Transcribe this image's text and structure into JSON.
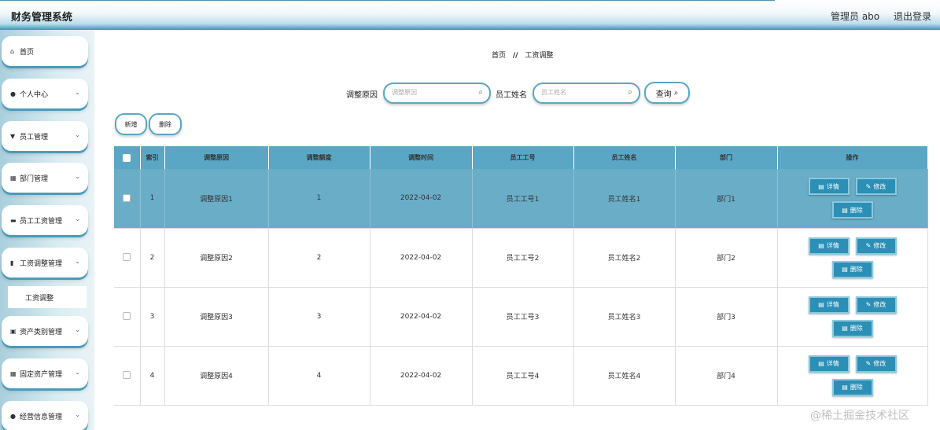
{
  "header": {
    "app_title": "财务管理系统",
    "user": "管理员 abo",
    "logout": "退出登录"
  },
  "sidebar": {
    "items": [
      {
        "label": "首页",
        "icon": "home-icon",
        "glyph": "⌂",
        "chevron": false
      },
      {
        "label": "个人中心",
        "icon": "user-icon",
        "glyph": "●",
        "chevron": true
      },
      {
        "label": "员工管理",
        "icon": "flask-icon",
        "glyph": "▼",
        "chevron": true
      },
      {
        "label": "部门管理",
        "icon": "grid-icon",
        "glyph": "▦",
        "chevron": true
      },
      {
        "label": "员工工资管理",
        "icon": "briefcase-icon",
        "glyph": "▬",
        "chevron": true
      },
      {
        "label": "工资调整管理",
        "icon": "bar-chart-icon",
        "glyph": "▮",
        "chevron": true
      },
      {
        "label": "资产类别管理",
        "icon": "clipboard-icon",
        "glyph": "▣",
        "chevron": true
      },
      {
        "label": "固定资产管理",
        "icon": "grid-icon",
        "glyph": "▦",
        "chevron": true
      },
      {
        "label": "经营信息管理",
        "icon": "pin-icon",
        "glyph": "●",
        "chevron": true
      }
    ],
    "sub_item": "工资调整"
  },
  "breadcrumb": {
    "home": "首页",
    "sep": "//",
    "current": "工资调整"
  },
  "search": {
    "reason_label": "调整原因",
    "reason_placeholder": "调整原因",
    "name_label": "员工姓名",
    "name_placeholder": "员工姓名",
    "query_label": "查询"
  },
  "actions": {
    "add": "新增",
    "delete": "删除"
  },
  "table": {
    "headers": [
      "索引",
      "调整原因",
      "调整额度",
      "调整时间",
      "员工工号",
      "员工姓名",
      "部门",
      "操作"
    ],
    "rows": [
      {
        "index": "1",
        "reason": "调整原因1",
        "amount": "1",
        "time": "2022-04-02",
        "emp_no": "员工工号1",
        "emp_name": "员工姓名1",
        "dept": "部门1"
      },
      {
        "index": "2",
        "reason": "调整原因2",
        "amount": "2",
        "time": "2022-04-02",
        "emp_no": "员工工号2",
        "emp_name": "员工姓名2",
        "dept": "部门2"
      },
      {
        "index": "3",
        "reason": "调整原因3",
        "amount": "3",
        "time": "2022-04-02",
        "emp_no": "员工工号3",
        "emp_name": "员工姓名3",
        "dept": "部门3"
      },
      {
        "index": "4",
        "reason": "调整原因4",
        "amount": "4",
        "time": "2022-04-02",
        "emp_no": "员工工号4",
        "emp_name": "员工姓名4",
        "dept": "部门4"
      }
    ],
    "op_labels": {
      "detail": "详情",
      "edit": "修改",
      "delete": "删除"
    }
  },
  "watermark": "@稀土掘金技术社区",
  "colors": {
    "accent": "#5aa7c5",
    "button": "#2b8fb6",
    "active_row": "#6aadc7"
  }
}
